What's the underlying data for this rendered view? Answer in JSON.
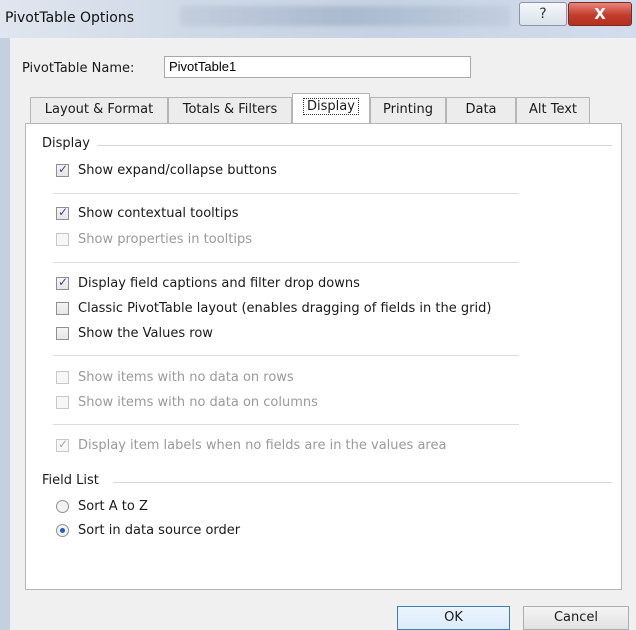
{
  "window": {
    "title": "PivotTable Options",
    "help_label": "?",
    "close_label": "X"
  },
  "name_field": {
    "label": "PivotTable Name:",
    "value": "PivotTable1"
  },
  "tabs": [
    {
      "label": "Layout & Format",
      "active": false
    },
    {
      "label": "Totals & Filters",
      "active": false
    },
    {
      "label": "Display",
      "active": true
    },
    {
      "label": "Printing",
      "active": false
    },
    {
      "label": "Data",
      "active": false
    },
    {
      "label": "Alt Text",
      "active": false
    }
  ],
  "display_group": {
    "label": "Display",
    "options": [
      {
        "label": "Show expand/collapse buttons",
        "checked": true,
        "enabled": true
      },
      {
        "label": "Show contextual tooltips",
        "checked": true,
        "enabled": true
      },
      {
        "label": "Show properties in tooltips",
        "checked": false,
        "enabled": false
      },
      {
        "label": "Display field captions and filter drop downs",
        "checked": true,
        "enabled": true
      },
      {
        "label": "Classic PivotTable layout (enables dragging of fields in the grid)",
        "checked": false,
        "enabled": true
      },
      {
        "label": "Show the Values row",
        "checked": false,
        "enabled": true
      },
      {
        "label": "Show items with no data on rows",
        "checked": false,
        "enabled": false
      },
      {
        "label": "Show items with no data on columns",
        "checked": false,
        "enabled": false
      },
      {
        "label": "Display item labels when no fields are in the values area",
        "checked": true,
        "enabled": false
      }
    ]
  },
  "field_list_group": {
    "label": "Field List",
    "options": [
      {
        "label": "Sort A to Z",
        "selected": false
      },
      {
        "label": "Sort in data source order",
        "selected": true
      }
    ]
  },
  "buttons": {
    "ok_label": "OK",
    "cancel_label": "Cancel"
  }
}
